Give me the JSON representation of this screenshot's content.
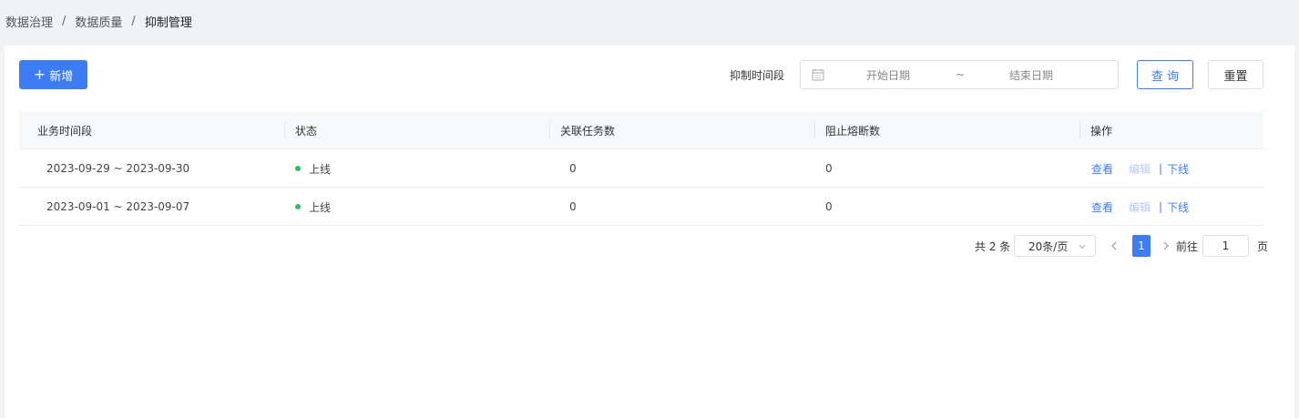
{
  "breadcrumb": {
    "items": [
      "数据治理",
      "数据质量",
      "抑制管理"
    ],
    "separator": "/"
  },
  "toolbar": {
    "add_label": "新增",
    "filter_label": "抑制时间段",
    "date_start_placeholder": "开始日期",
    "date_separator": "~",
    "date_end_placeholder": "结束日期",
    "query_label": "查 询",
    "reset_label": "重置"
  },
  "table": {
    "columns": [
      "业务时间段",
      "状态",
      "关联任务数",
      "阻止熔断数",
      "操作"
    ],
    "rows": [
      {
        "period": "2023-09-29 ~ 2023-09-30",
        "status": "上线",
        "tasks": "0",
        "blocked": "0"
      },
      {
        "period": "2023-09-01 ~ 2023-09-07",
        "status": "上线",
        "tasks": "0",
        "blocked": "0"
      }
    ],
    "actions": {
      "view": "查看",
      "edit": "编辑",
      "sep": "|",
      "offline": "下线"
    }
  },
  "pagination": {
    "total_text": "共 2 条",
    "page_size": "20条/页",
    "current_page": "1",
    "goto_label": "前往",
    "goto_value": "1",
    "goto_suffix": "页"
  },
  "colors": {
    "primary": "#3c7cf5",
    "status_online": "#22c55e",
    "disabled_link": "#b3cbf7"
  }
}
